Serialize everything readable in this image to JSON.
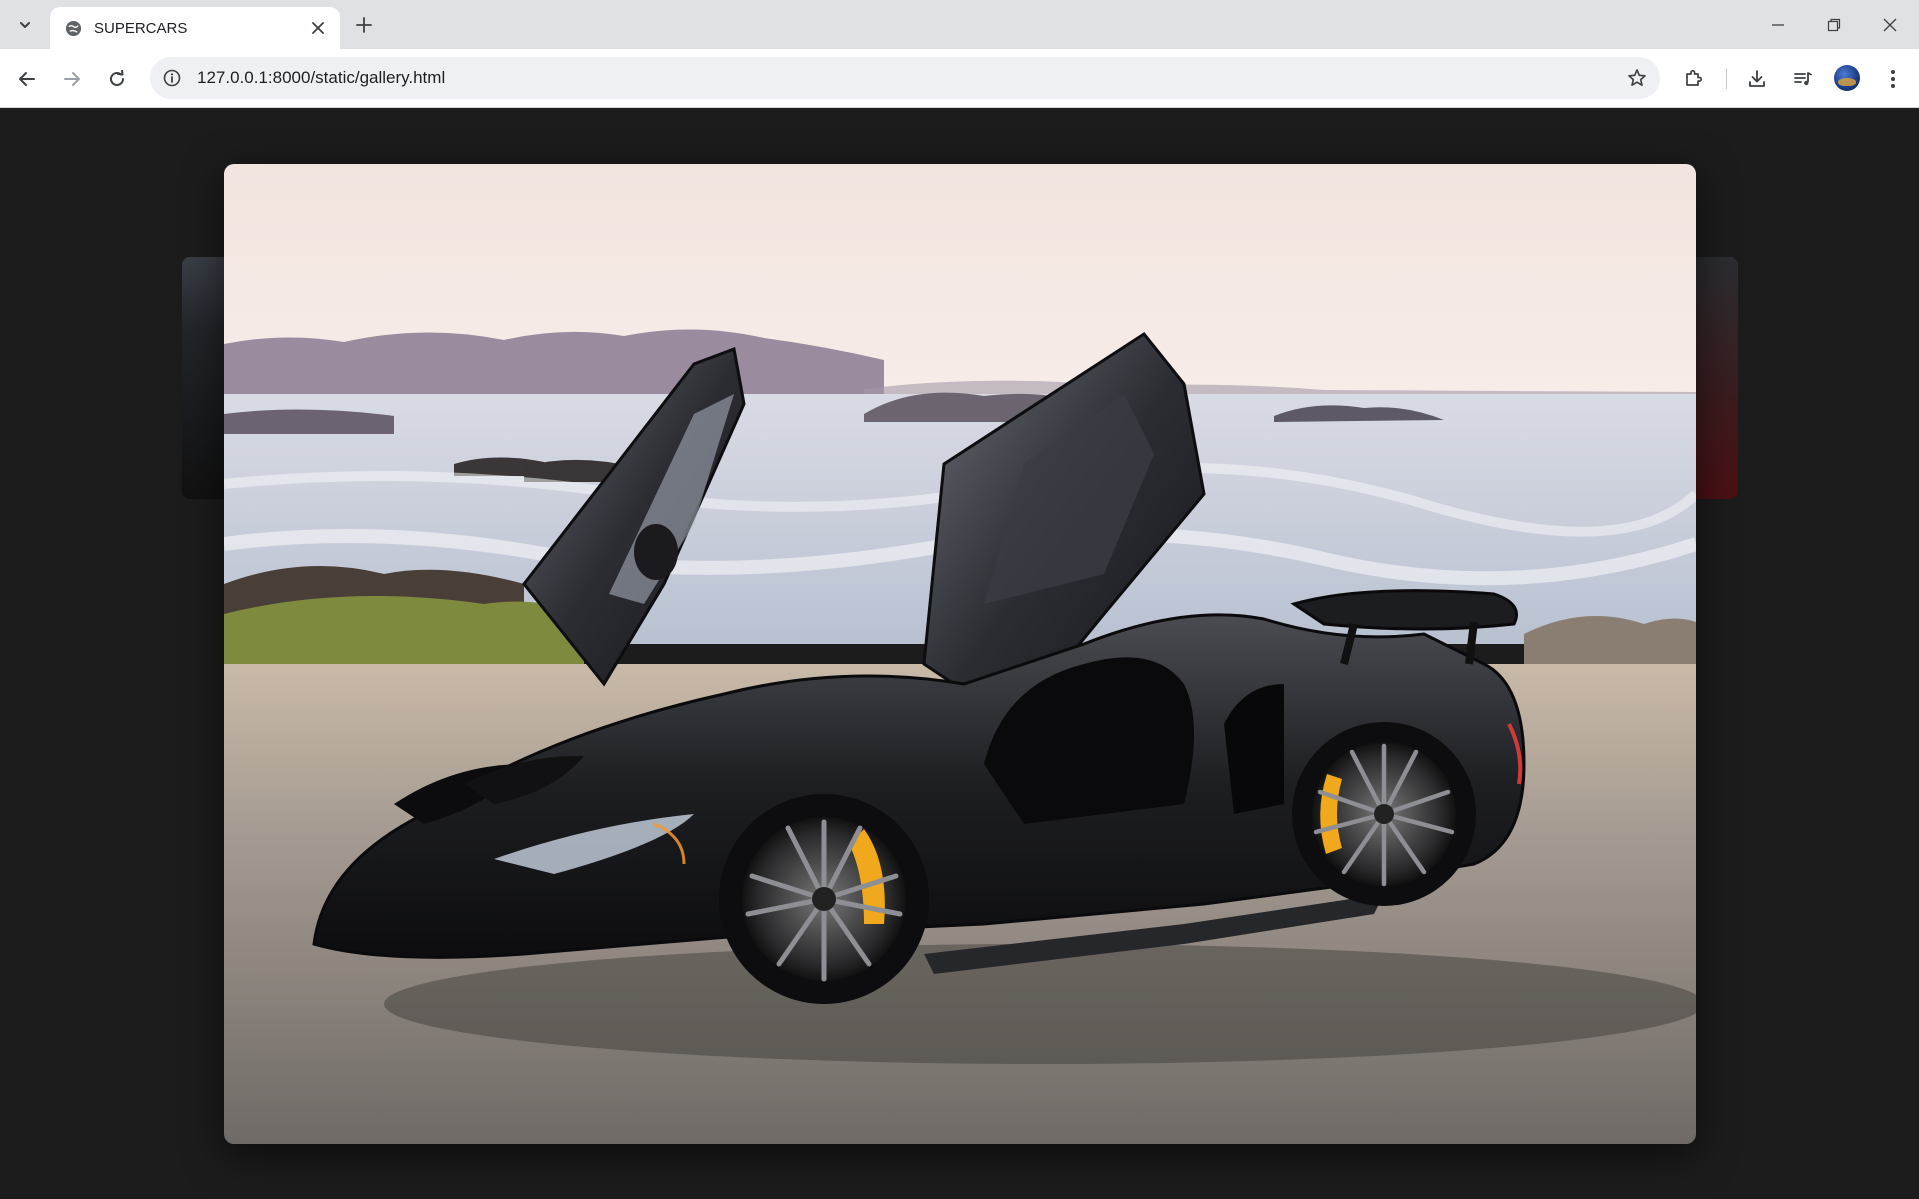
{
  "browser": {
    "tab": {
      "title": "SUPERCARS",
      "favicon": "globe-icon"
    },
    "address_bar": {
      "url": "127.0.0.1:8000/static/gallery.html"
    },
    "window_controls": [
      "minimize-icon",
      "restore-icon",
      "close-icon"
    ],
    "toolbar_icons": [
      "extensions-icon",
      "download-icon",
      "media-controls-icon",
      "profile-avatar",
      "menu-icon"
    ]
  },
  "page": {
    "background": "#1c1c1c",
    "lightbox": {
      "subject": "black supercar with open dihedral doors parked by a rocky coastline",
      "colors": {
        "sky": "#f3e6e3",
        "sea": "#c9cfdb",
        "car_body": "#1a1a1e",
        "caliper": "#f0a81c",
        "road": "#8d8782"
      }
    }
  }
}
